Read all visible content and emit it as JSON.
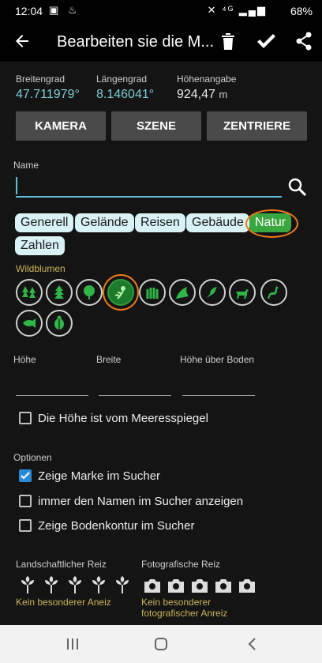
{
  "status": {
    "time": "12:04",
    "battery": "68%"
  },
  "appbar": {
    "title": "Bearbeiten sie die M..."
  },
  "coordinates": [
    {
      "label": "Breitengrad",
      "value": "47.711979°",
      "unit": ""
    },
    {
      "label": "Längengrad",
      "value": "8.146041°",
      "unit": ""
    },
    {
      "label": "Höhenangabe",
      "value": "924,47",
      "unit": "m"
    }
  ],
  "buttons": {
    "camera": "KAMERA",
    "scene": "SZENE",
    "center": "ZENTRIERE"
  },
  "name_field": {
    "label": "Name",
    "value": "",
    "placeholder": ""
  },
  "categories": [
    "Generell",
    "Gelände",
    "Reisen",
    "Gebäude",
    "Natur",
    "Zahlen"
  ],
  "selected_category": "Natur",
  "subcategory_label": "Wildblumen",
  "icons": [
    "forest-icon",
    "conifer-icon",
    "deciduous-tree-icon",
    "wildflower-icon",
    "grain-icon",
    "rock-icon",
    "bird-icon",
    "deer-icon",
    "doe-icon",
    "fish-icon",
    "ladybug-icon"
  ],
  "selected_icon": "wildflower-icon",
  "dimensions": {
    "height_label": "Höhe",
    "width_label": "Breite",
    "agl_label": "Höhe über Boden"
  },
  "sea_level_checkbox": {
    "label": "Die Höhe ist vom Meeresspiegel",
    "checked": false
  },
  "options": {
    "title": "Optionen",
    "items": [
      {
        "label": "Zeige Marke im Sucher",
        "checked": true
      },
      {
        "label": "immer den Namen im Sucher anzeigen",
        "checked": false
      },
      {
        "label": "Zeige Bodenkontur im Sucher",
        "checked": false
      }
    ]
  },
  "ratings": {
    "landscape": {
      "label": "Landschaftlicher Reiz",
      "value_text": "Kein besonderer Aneiz",
      "rating": 0
    },
    "photo": {
      "label": "Fotografische Reiz",
      "value_text_1": "Kein besonderer",
      "value_text_2": "fotografischer Anreiz",
      "rating": 0
    }
  },
  "colors": {
    "accent": "#7ecdd6",
    "natur_active": "#3aa63f",
    "highlight": "#f07a1a",
    "sub_yellow": "#c9b65a"
  }
}
